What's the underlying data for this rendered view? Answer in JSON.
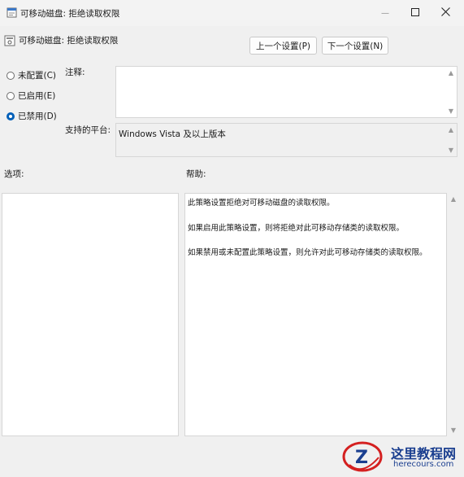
{
  "window": {
    "title": "可移动磁盘: 拒绝读取权限",
    "minimize_glyph": "—",
    "maximize_glyph": "☐",
    "close_glyph": "✕"
  },
  "header": {
    "policy_name": "可移动磁盘: 拒绝读取权限",
    "prev_button": "上一个设置(P)",
    "next_button": "下一个设置(N)"
  },
  "options": {
    "not_configured": "未配置(C)",
    "enabled": "已启用(E)",
    "disabled": "已禁用(D)",
    "selected": "disabled"
  },
  "comment": {
    "label": "注释:",
    "value": ""
  },
  "platform": {
    "label": "支持的平台:",
    "value": "Windows Vista 及以上版本"
  },
  "sections": {
    "options_label": "选项:",
    "help_label": "帮助:"
  },
  "help": {
    "lines": [
      "此策略设置拒绝对可移动磁盘的读取权限。",
      "如果启用此策略设置，则将拒绝对此可移动存储类的读取权限。",
      "如果禁用或未配置此策略设置，则允许对此可移动存储类的读取权限。"
    ]
  },
  "watermark": {
    "title": "这里教程网",
    "url": "herecours.com",
    "logo_letter": "Z"
  },
  "colors": {
    "accent": "#005fb8",
    "window_bg": "#f0f0f0",
    "box_bg": "#ffffff",
    "watermark_blue": "#1a3e8f",
    "watermark_red": "#d42020"
  },
  "icons": {
    "window_icon": "policy-document-icon",
    "setting_icon": "policy-setting-icon"
  }
}
